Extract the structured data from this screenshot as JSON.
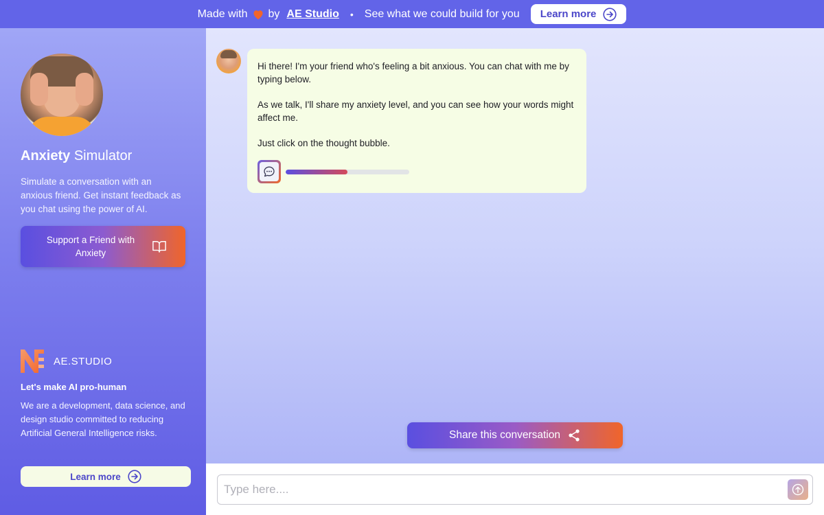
{
  "banner": {
    "made_with": "Made with",
    "by": "by",
    "studio_link": "AE Studio",
    "separator": "•",
    "pitch": "See what we could build for you",
    "learn_more": "Learn more"
  },
  "sidebar": {
    "title_bold": "Anxiety",
    "title_rest": "Simulator",
    "description": "Simulate a conversation with an anxious friend. Get instant feedback as you chat using the power of AI.",
    "support_button": "Support a Friend with Anxiety",
    "brand_name": "AE.STUDIO",
    "tagline": "Let's make AI pro-human",
    "about": "We are a development, data science, and design studio committed to reducing Artificial General Intelligence risks.",
    "learn_more": "Learn more"
  },
  "chat": {
    "messages": [
      {
        "sender": "friend",
        "paragraphs": [
          "Hi there! I'm your friend who's feeling a bit anxious. You can chat with me by typing below.",
          "As we talk, I'll share my anxiety level, and you can see how your words might affect me.",
          "Just click on the thought bubble."
        ],
        "anxiety_level": 0.5
      }
    ],
    "share_button": "Share this conversation"
  },
  "composer": {
    "placeholder": "Type here...."
  },
  "colors": {
    "banner": "#6264e8",
    "accent_purple": "#5a4fe0",
    "accent_orange": "#f0652a",
    "bubble": "#f6fde5"
  }
}
